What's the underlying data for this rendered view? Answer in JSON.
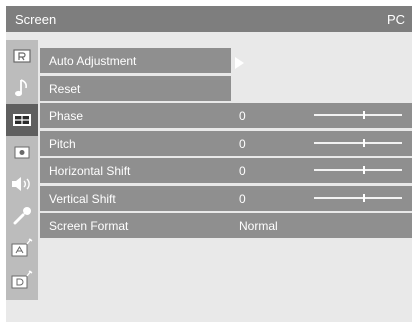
{
  "header": {
    "title": "Screen",
    "source": "PC"
  },
  "sidebar": {
    "icons": [
      {
        "name": "picture-icon",
        "selected": false
      },
      {
        "name": "music-note-icon",
        "selected": false
      },
      {
        "name": "screen-icon",
        "selected": true
      },
      {
        "name": "camera-icon",
        "selected": false
      },
      {
        "name": "speaker-icon",
        "selected": false
      },
      {
        "name": "wrench-icon",
        "selected": false
      },
      {
        "name": "antenna-a-icon",
        "selected": false
      },
      {
        "name": "antenna-d-icon",
        "selected": false
      }
    ]
  },
  "menu": {
    "items": [
      {
        "label": "Auto Adjustment",
        "has_submenu": true
      },
      {
        "label": "Reset"
      },
      {
        "label": "Phase",
        "value": "0",
        "slider_level": 0.57
      },
      {
        "label": "Pitch",
        "value": "0",
        "slider_level": 0.57
      },
      {
        "label": "Horizontal Shift",
        "value": "0",
        "slider_level": 0.57
      },
      {
        "label": "Vertical Shift",
        "value": "0",
        "slider_level": 0.57
      },
      {
        "label": "Screen Format",
        "value": "Normal"
      }
    ]
  },
  "colors": {
    "title_bar": "#7e7e7e",
    "menu_row": "#8f8f8f",
    "icon_column": "#bcbcbc",
    "selected_icon": "#5f5f5f",
    "panel": "#e9e9e9"
  }
}
